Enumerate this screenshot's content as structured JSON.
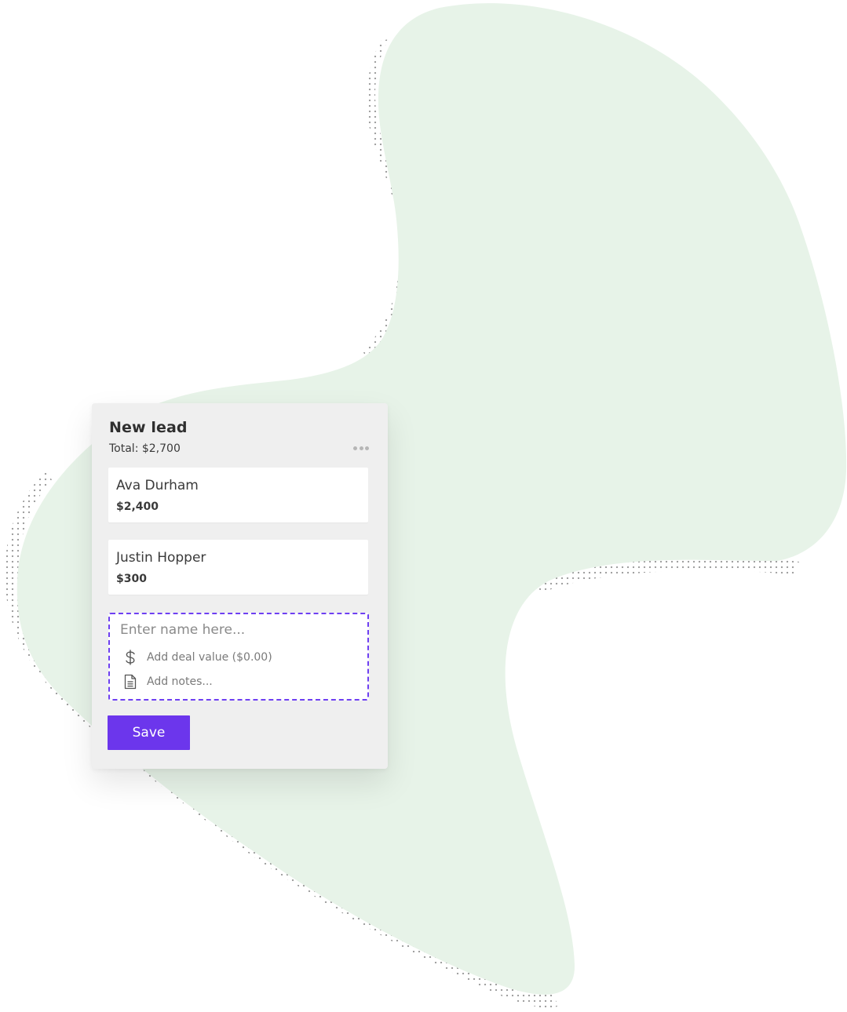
{
  "colors": {
    "blob": "#e7f3e8",
    "dots": "#9a9a9a",
    "accent": "#6c36ec",
    "dashed_border": "#6e3ff2",
    "card_bg": "#efefef"
  },
  "column": {
    "title": "New lead",
    "total": "Total: $2,700",
    "menu_icon": "more-horizontal-icon"
  },
  "deals": [
    {
      "name": "Ava Durham",
      "value": "$2,400"
    },
    {
      "name": "Justin Hopper",
      "value": "$300"
    }
  ],
  "new_deal_form": {
    "name_placeholder": "Enter name here...",
    "deal_value_label": "Add deal value ($0.00)",
    "deal_value_icon": "dollar-icon",
    "notes_label": "Add notes...",
    "notes_icon": "document-icon"
  },
  "save_label": "Save"
}
